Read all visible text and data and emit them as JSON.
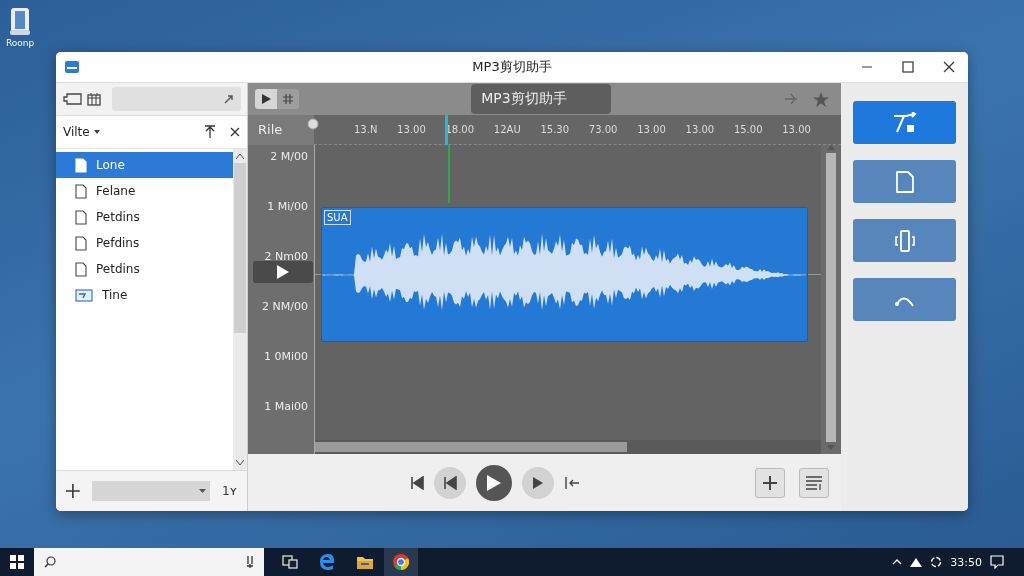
{
  "desktop_icons": [
    {
      "label": "Roonp"
    }
  ],
  "window": {
    "title": "MP3剪切助手"
  },
  "sidebar": {
    "header": "Vilte",
    "items": [
      {
        "name": "Lone",
        "kind": "file",
        "selected": true
      },
      {
        "name": "Felane",
        "kind": "file",
        "selected": false
      },
      {
        "name": "Petdins",
        "kind": "file",
        "selected": false
      },
      {
        "name": "Pefdins",
        "kind": "file",
        "selected": false
      },
      {
        "name": "Petdins",
        "kind": "file",
        "selected": false
      },
      {
        "name": "Tine",
        "kind": "image",
        "selected": false
      }
    ],
    "footer_text": "1ʏ"
  },
  "editor": {
    "view_modes": [
      {
        "kind": "play",
        "selected": true
      },
      {
        "kind": "grid",
        "selected": false
      }
    ],
    "title": "MP3剪切助手",
    "track_label": "Rile",
    "clip_label": "SUA",
    "ruler": [
      "13.N",
      "13.00",
      "18.00",
      "12AU",
      "15.30",
      "73.00",
      "13.00",
      "13.00",
      "15.00",
      "13.00"
    ],
    "levels": [
      "2 M/00",
      "1 Mi/00",
      "2 Nm00",
      "2 NM/00",
      "1 0Mi00",
      "1 Mai00"
    ]
  },
  "tools": [
    {
      "kind": "trim",
      "selected": true
    },
    {
      "kind": "file",
      "selected": false
    },
    {
      "kind": "split",
      "selected": false
    },
    {
      "kind": "fade",
      "selected": false
    }
  ],
  "taskbar": {
    "clock": "33:50"
  }
}
